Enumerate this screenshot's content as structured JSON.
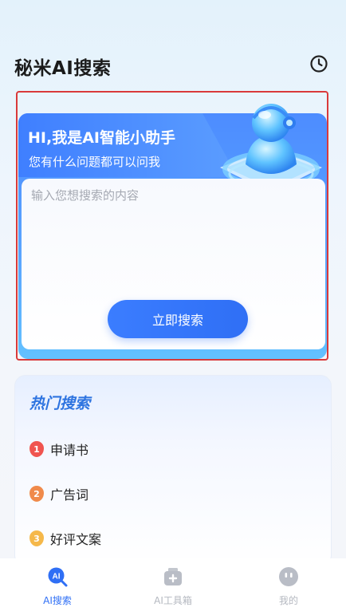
{
  "header": {
    "title": "秘米AI搜索",
    "history_icon": "clock-icon"
  },
  "hero": {
    "title": "HI,我是AI智能小助手",
    "subtitle": "您有什么问题都可以问我",
    "input_placeholder": "输入您想搜索的内容",
    "input_value": "",
    "search_button": "立即搜索",
    "illustration": "robot-assistant-icon"
  },
  "hot_search": {
    "title": "热门搜索",
    "items": [
      {
        "rank": "1",
        "label": "申请书",
        "color": "#f0544f"
      },
      {
        "rank": "2",
        "label": "广告词",
        "color": "#f08a4b"
      },
      {
        "rank": "3",
        "label": "好评文案",
        "color": "#f5b84a"
      }
    ]
  },
  "tabbar": {
    "items": [
      {
        "label": "AI搜索",
        "icon": "ai-search-icon",
        "active": true
      },
      {
        "label": "AI工具箱",
        "icon": "toolbox-icon",
        "active": false
      },
      {
        "label": "我的",
        "icon": "profile-face-icon",
        "active": false
      }
    ]
  },
  "colors": {
    "accent": "#2f6ff5",
    "highlight_border": "#d93a3a",
    "hot_title": "#2e74e0"
  }
}
